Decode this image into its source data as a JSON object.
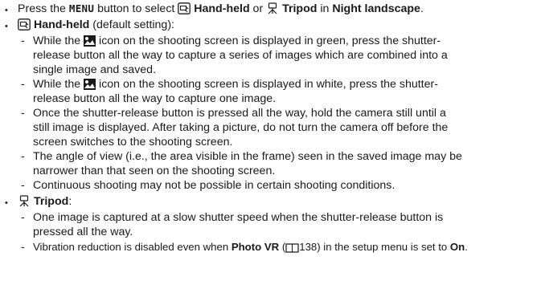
{
  "line1": {
    "pre": "Press the ",
    "menu": "MENU",
    "mid1": " button to select ",
    "handheld": "Hand-held",
    "or": " or ",
    "tripod": "Tripod",
    "in": " in ",
    "night": "Night landscape",
    "end": "."
  },
  "handheld_heading": {
    "label": "Hand-held",
    "suffix": " (default setting):"
  },
  "handheld_items": {
    "a1": "While the ",
    "a2": " icon on the shooting screen is displayed in green, press the shutter-",
    "a3": "release button all the way to capture a series of images which are combined into a",
    "a4": "single image and saved.",
    "b1": "While the ",
    "b2": " icon on the shooting screen is displayed in white, press the shutter-",
    "b3": "release button all the way to capture one image.",
    "c1": "Once the shutter-release button is pressed all the way, hold the camera still until a",
    "c2": "still image is displayed. After taking a picture, do not turn the camera off before the",
    "c3": "screen switches to the shooting screen.",
    "d1": "The angle of view (i.e., the area visible in the frame) seen in the saved image may be",
    "d2": "narrower than that seen on the shooting screen.",
    "e1": "Continuous shooting may not be possible in certain shooting conditions."
  },
  "tripod_heading": {
    "label": "Tripod",
    "suffix": ":"
  },
  "tripod_items": {
    "a1": "One image is captured at a slow shutter speed when the shutter-release button is",
    "a2": "pressed all the way.",
    "b1": "Vibration reduction is disabled even when ",
    "b_bold": "Photo VR",
    "b2": " (",
    "b_page": "138",
    "b3": ") in the setup menu is set to ",
    "b_on": "On",
    "b4": "."
  },
  "symbols": {
    "bullet": "•",
    "dash": "-"
  },
  "icons": [
    "hand-held-icon",
    "tripod-icon",
    "night-landscape-mode-icon",
    "page-reference-book-icon"
  ]
}
